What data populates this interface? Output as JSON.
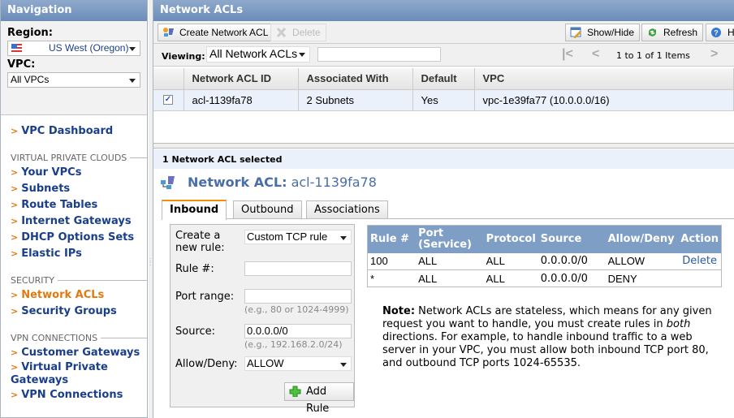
{
  "nav": {
    "title": "Navigation",
    "region_label": "Region:",
    "region_value": "US West (Oregon)",
    "vpc_label": "VPC:",
    "vpc_value": "All VPCs",
    "dashboard": "VPC Dashboard",
    "sections": [
      {
        "title": "VIRTUAL PRIVATE CLOUDS",
        "items": [
          "Your VPCs",
          "Subnets",
          "Route Tables",
          "Internet Gateways",
          "DHCP Options Sets",
          "Elastic IPs"
        ]
      },
      {
        "title": "SECURITY",
        "items": [
          "Network ACLs",
          "Security Groups"
        ]
      },
      {
        "title": "VPN CONNECTIONS",
        "items": [
          "Customer Gateways",
          "Virtual Private Gateways",
          "VPN Connections"
        ]
      }
    ],
    "active_item": "Network ACLs"
  },
  "main": {
    "title": "Network ACLs",
    "toolbar": {
      "create": "Create Network ACL",
      "delete": "Delete",
      "showhide": "Show/Hide",
      "refresh": "Refresh",
      "help": "Help"
    },
    "viewing_label": "Viewing:",
    "viewing_value": "All Network ACLs",
    "filter_value": "",
    "pagination": "1 to 1 of 1 Items",
    "columns": [
      "Network ACL ID",
      "Associated With",
      "Default",
      "VPC"
    ],
    "rows": [
      {
        "checked": true,
        "id": "acl-1139fa78",
        "assoc": "2 Subnets",
        "default": "Yes",
        "vpc": "vpc-1e39fa77 (10.0.0.0/16)"
      }
    ],
    "selected_text": "1 Network ACL selected"
  },
  "detail": {
    "title_label": "Network ACL:",
    "title_value": "acl-1139fa78",
    "tabs": [
      "Inbound",
      "Outbound",
      "Associations"
    ],
    "active_tab": "Inbound",
    "form": {
      "create_label": "Create a new rule:",
      "create_value": "Custom TCP rule",
      "rule_label": "Rule #:",
      "rule_value": "",
      "port_label": "Port range:",
      "port_value": "",
      "port_hint": "(e.g., 80 or 1024-4999)",
      "source_label": "Source:",
      "source_value": "0.0.0.0/0",
      "source_hint": "(e.g., 192.168.2.0/24)",
      "allow_label": "Allow/Deny:",
      "allow_value": "ALLOW",
      "add_button": "Add Rule"
    },
    "rules_columns": [
      "Rule #",
      "Port (Service)",
      "Protocol",
      "Source",
      "Allow/Deny",
      "Action"
    ],
    "rules": [
      {
        "rule": "100",
        "port": "ALL",
        "protocol": "ALL",
        "source": "0.0.0.0/0",
        "allow": "ALLOW",
        "action": "Delete"
      },
      {
        "rule": "*",
        "port": "ALL",
        "protocol": "ALL",
        "source": "0.0.0.0/0",
        "allow": "DENY",
        "action": ""
      }
    ],
    "note_bold": "Note:",
    "note_text1": " Network ACLs are stateless, which means for any given request you want to handle, you must create rules in ",
    "note_italic": "both",
    "note_text2": " directions. For example, to handle inbound traffic to a web server in your VPC, you must allow both inbound TCP port 80, and outbound TCP ports 1024-65535."
  }
}
